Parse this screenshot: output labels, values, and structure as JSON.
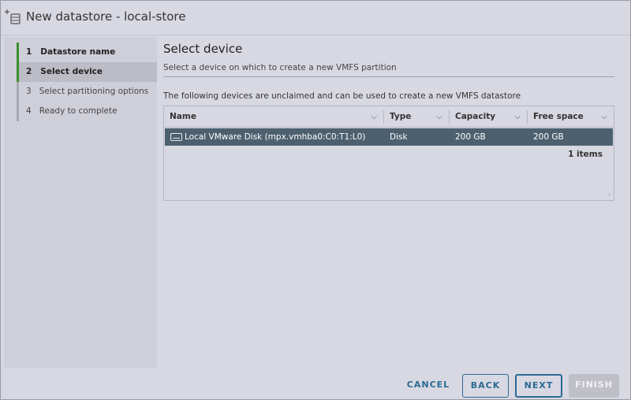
{
  "dialog": {
    "title": "New datastore - local-store",
    "title_icon": "add-datastore-icon"
  },
  "steps": [
    {
      "number": "1",
      "label": "Datastore name",
      "state": "done"
    },
    {
      "number": "2",
      "label": "Select device",
      "state": "current"
    },
    {
      "number": "3",
      "label": "Select partitioning options",
      "state": "pending"
    },
    {
      "number": "4",
      "label": "Ready to complete",
      "state": "pending"
    }
  ],
  "content": {
    "title": "Select device",
    "subtitle": "Select a device on which to create a new VMFS partition",
    "description": "The following devices are unclaimed and can be used to create a new VMFS datastore"
  },
  "grid": {
    "columns": [
      "Name",
      "Type",
      "Capacity",
      "Free space"
    ],
    "rows": [
      {
        "name": "Local VMware Disk (mpx.vmhba0:C0:T1:L0)",
        "type": "Disk",
        "capacity": "200 GB",
        "free_space": "200 GB",
        "icon": "disk-icon"
      }
    ],
    "count_label": "1 items"
  },
  "footer": {
    "cancel_label": "CANCEL",
    "back_label": "BACK",
    "next_label": "NEXT",
    "finish_label": "FINISH"
  },
  "colors": {
    "accent": "#2a6a94",
    "selected_row": "#4c6070",
    "step_done": "#3e8e2e"
  }
}
